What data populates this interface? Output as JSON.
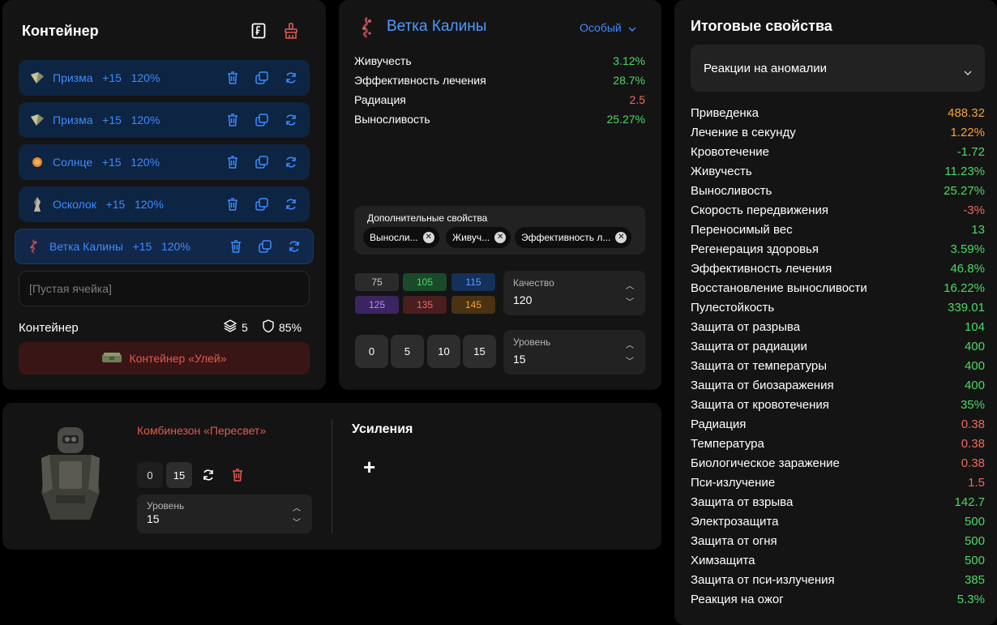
{
  "container": {
    "title": "Контейнер",
    "slots": [
      {
        "name": "Призма",
        "upgrade": "+15",
        "quality": "120%"
      },
      {
        "name": "Призма",
        "upgrade": "+15",
        "quality": "120%"
      },
      {
        "name": "Солнце",
        "upgrade": "+15",
        "quality": "120%"
      },
      {
        "name": "Осколок",
        "upgrade": "+15",
        "quality": "120%"
      },
      {
        "name": "Ветка Калины",
        "upgrade": "+15",
        "quality": "120%"
      }
    ],
    "empty_slot": "[Пустая ячейка]",
    "footer_label": "Контейнер",
    "capacity": "5",
    "protection": "85%",
    "hive_button": "Контейнер «Улей»"
  },
  "artifact": {
    "name": "Ветка Калины",
    "rarity": "Особый",
    "stats": [
      {
        "label": "Живучесть",
        "value": "3.12%",
        "tone": "green"
      },
      {
        "label": "Эффективность лечения",
        "value": "28.7%",
        "tone": "green"
      },
      {
        "label": "Радиация",
        "value": "2.5",
        "tone": "red"
      },
      {
        "label": "Выносливость",
        "value": "25.27%",
        "tone": "green"
      }
    ],
    "extra_title": "Дополнительные свойства",
    "extra_chips": [
      "Выносли...",
      "Живуч...",
      "Эффективность л..."
    ],
    "quality_options": [
      {
        "value": "75",
        "bg": "#2b2b2b",
        "fg": "#c9c9c9"
      },
      {
        "value": "105",
        "bg": "#1a4a2a",
        "fg": "#4cd964"
      },
      {
        "value": "115",
        "bg": "#15305a",
        "fg": "#5aa0ff"
      },
      {
        "value": "125",
        "bg": "#3a2560",
        "fg": "#b48cff"
      },
      {
        "value": "135",
        "bg": "#4a1e1e",
        "fg": "#e86a6a"
      },
      {
        "value": "145",
        "bg": "#4a3212",
        "fg": "#f2a43a"
      }
    ],
    "quality_label": "Качество",
    "quality_value": "120",
    "level_buttons": [
      "0",
      "5",
      "10",
      "15"
    ],
    "level_label": "Уровень",
    "level_value": "15"
  },
  "suit": {
    "name": "Комбинезон «Пересвет»",
    "level_buttons": [
      "0",
      "15"
    ],
    "level_label": "Уровень",
    "level_value": "15",
    "boosts_title": "Усиления",
    "add_symbol": "+"
  },
  "totals": {
    "title": "Итоговые свойства",
    "filter": "Реакции на аномалии",
    "rows": [
      {
        "label": "Приведенка",
        "value": "488.32",
        "tone": "orange"
      },
      {
        "label": "Лечение в секунду",
        "value": "1.22%",
        "tone": "orange"
      },
      {
        "label": "Кровотечение",
        "value": "-1.72",
        "tone": "green"
      },
      {
        "label": "Живучесть",
        "value": "11.23%",
        "tone": "green"
      },
      {
        "label": "Выносливость",
        "value": "25.27%",
        "tone": "green"
      },
      {
        "label": "Скорость передвижения",
        "value": "-3%",
        "tone": "red"
      },
      {
        "label": "Переносимый вес",
        "value": "13",
        "tone": "green"
      },
      {
        "label": "Регенерация здоровья",
        "value": "3.59%",
        "tone": "green"
      },
      {
        "label": "Эффективность лечения",
        "value": "46.8%",
        "tone": "green"
      },
      {
        "label": "Восстановление выносливости",
        "value": "16.22%",
        "tone": "green"
      },
      {
        "label": "Пулестойкость",
        "value": "339.01",
        "tone": "green"
      },
      {
        "label": "Защита от разрыва",
        "value": "104",
        "tone": "green"
      },
      {
        "label": "Защита от радиации",
        "value": "400",
        "tone": "green"
      },
      {
        "label": "Защита от температуры",
        "value": "400",
        "tone": "green"
      },
      {
        "label": "Защита от биозаражения",
        "value": "400",
        "tone": "green"
      },
      {
        "label": "Защита от кровотечения",
        "value": "35%",
        "tone": "green"
      },
      {
        "label": "Радиация",
        "value": "0.38",
        "tone": "red"
      },
      {
        "label": "Температура",
        "value": "0.38",
        "tone": "red"
      },
      {
        "label": "Биологическое заражение",
        "value": "0.38",
        "tone": "red"
      },
      {
        "label": "Пси-излучение",
        "value": "1.5",
        "tone": "red"
      },
      {
        "label": "Защита от взрыва",
        "value": "142.7",
        "tone": "green"
      },
      {
        "label": "Электрозащита",
        "value": "500",
        "tone": "green"
      },
      {
        "label": "Защита от огня",
        "value": "500",
        "tone": "green"
      },
      {
        "label": "Химзащита",
        "value": "500",
        "tone": "green"
      },
      {
        "label": "Защита от пси-излучения",
        "value": "385",
        "tone": "green"
      },
      {
        "label": "Реакция на ожог",
        "value": "5.3%",
        "tone": "green"
      }
    ]
  }
}
